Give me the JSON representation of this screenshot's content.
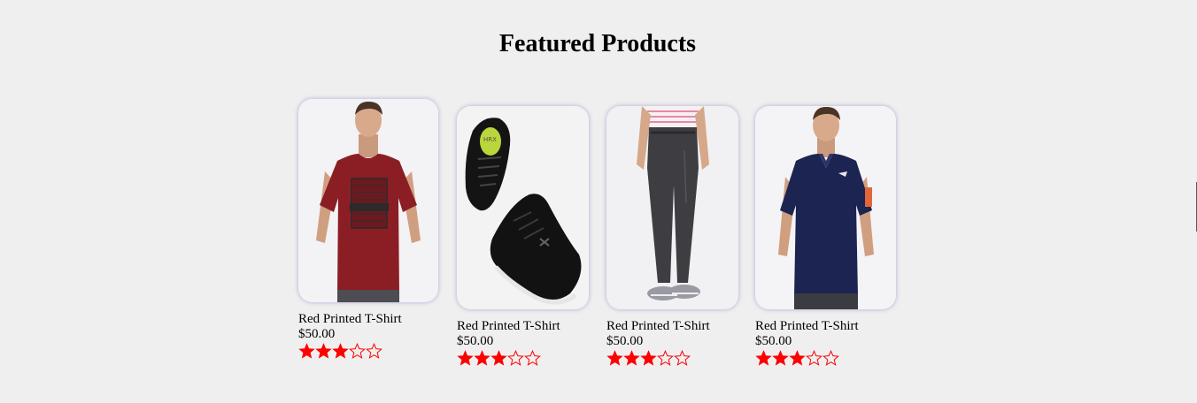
{
  "section": {
    "title": "Featured Products"
  },
  "products": [
    {
      "name": "Red Printed T-Shirt",
      "price": "$50.00",
      "rating": 3,
      "max_rating": 5,
      "image": "red-t-shirt-model"
    },
    {
      "name": "Red Printed T-Shirt",
      "price": "$50.00",
      "rating": 3,
      "max_rating": 5,
      "image": "black-sneakers"
    },
    {
      "name": "Red Printed T-Shirt",
      "price": "$50.00",
      "rating": 3,
      "max_rating": 5,
      "image": "grey-trousers-model"
    },
    {
      "name": "Red Printed T-Shirt",
      "price": "$50.00",
      "rating": 3,
      "max_rating": 5,
      "image": "navy-polo-model"
    }
  ],
  "colors": {
    "background": "#efefef",
    "star": "#ff0000",
    "card_bg": "#f2f1f4"
  }
}
